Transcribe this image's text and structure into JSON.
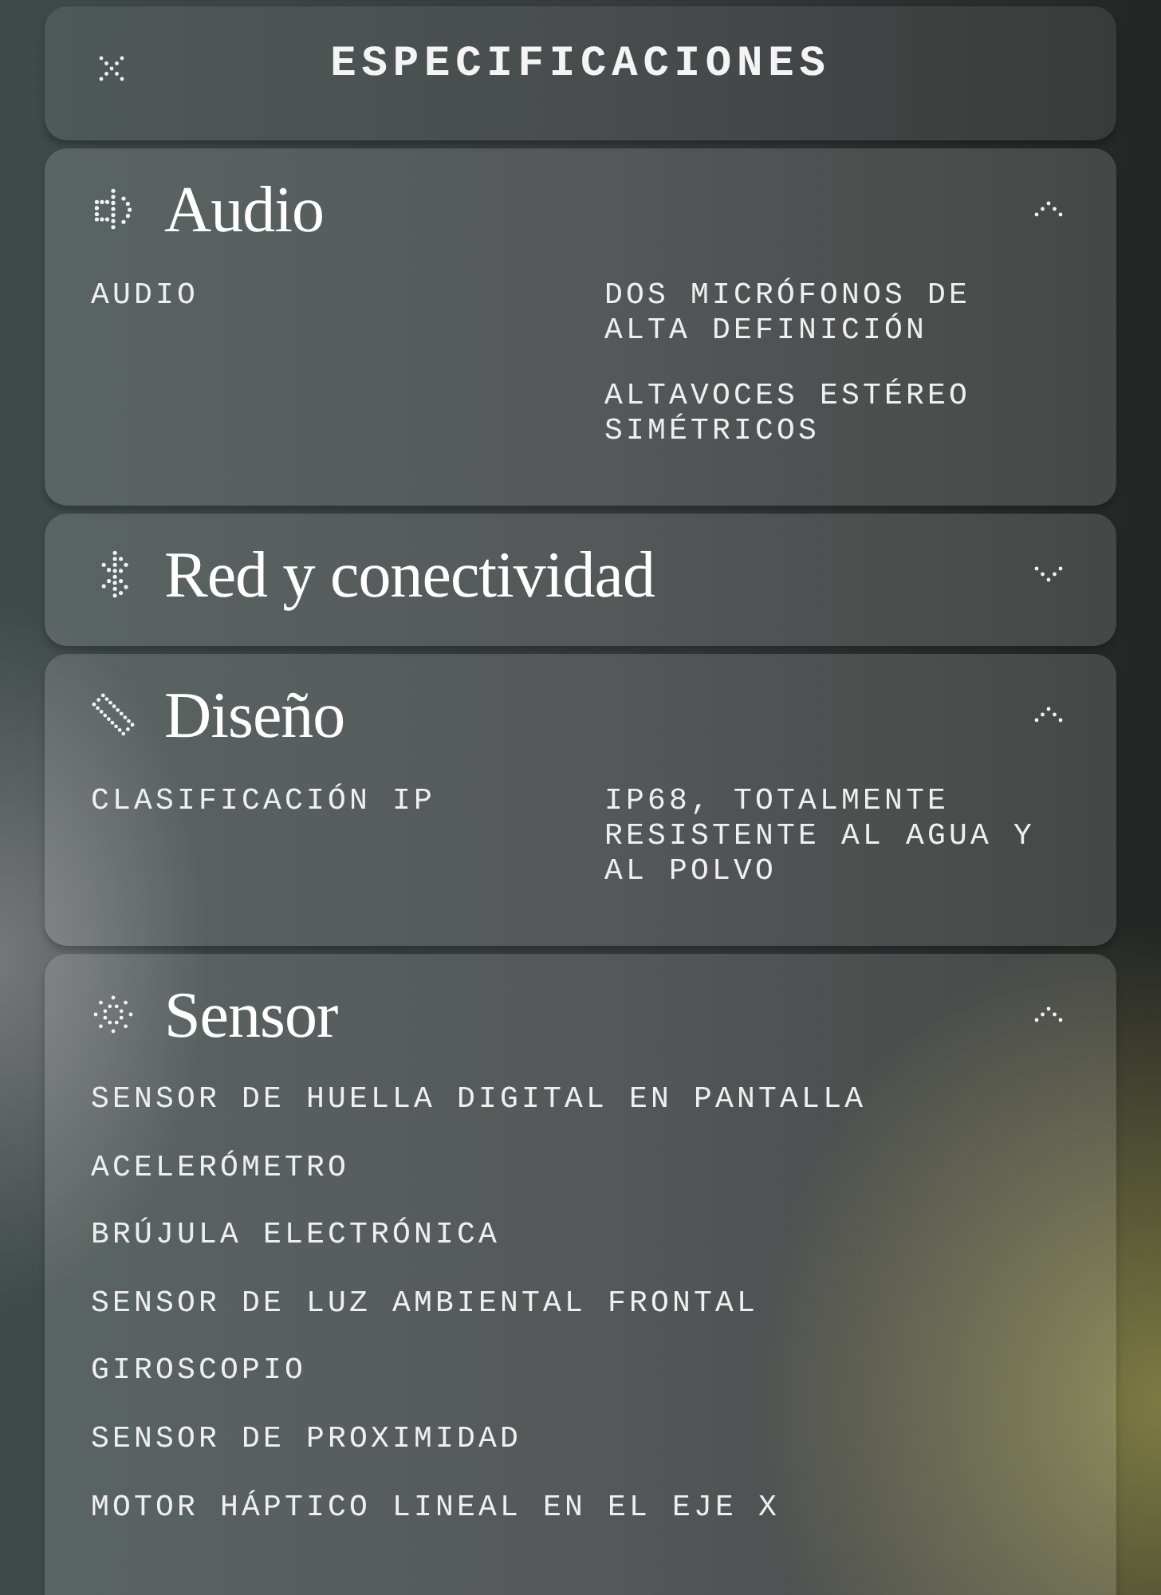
{
  "header": {
    "title": "ESPECIFICACIONES"
  },
  "sections": [
    {
      "title": "Audio",
      "expanded": true,
      "kind": "table",
      "rows": [
        {
          "label": "AUDIO",
          "values": [
            "DOS MICRÓFONOS DE ALTA DEFINICIÓN",
            "ALTAVOCES ESTÉREO SIMÉTRICOS"
          ]
        }
      ]
    },
    {
      "title": "Red y conectividad",
      "expanded": false
    },
    {
      "title": "Diseño",
      "expanded": true,
      "kind": "table",
      "rows": [
        {
          "label": "CLASIFICACIÓN IP",
          "values": [
            "IP68, TOTALMENTE RESISTENTE AL AGUA Y AL POLVO"
          ]
        }
      ]
    },
    {
      "title": "Sensor",
      "expanded": true,
      "kind": "list",
      "items": [
        "SENSOR DE HUELLA DIGITAL EN PANTALLA",
        "ACELERÓMETRO",
        "BRÚJULA ELECTRÓNICA",
        "SENSOR DE LUZ AMBIENTAL FRONTAL",
        "GIROSCOPIO",
        "SENSOR DE PROXIMIDAD",
        "MOTOR HÁPTICO LINEAL EN EL EJE X"
      ]
    }
  ]
}
